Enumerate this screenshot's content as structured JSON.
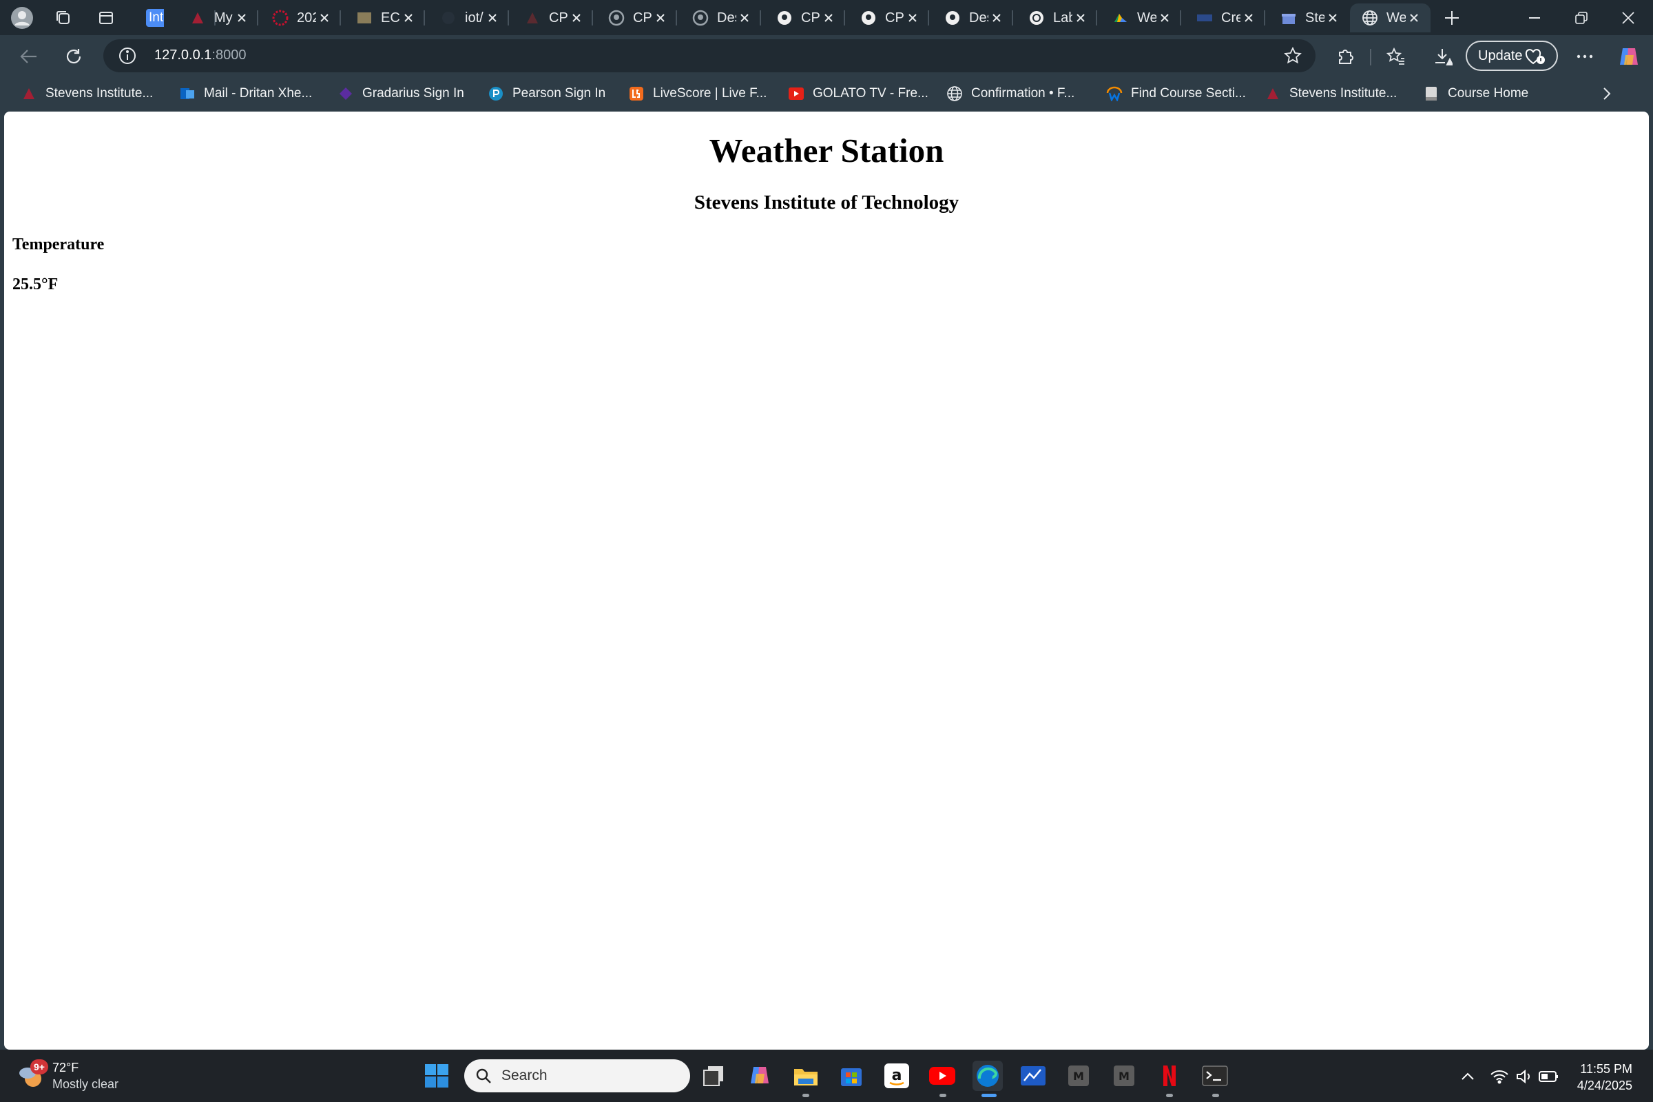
{
  "browser": {
    "tabs": [
      {
        "label": "Int",
        "icon": "int-badge-icon"
      },
      {
        "label": "My",
        "icon": "stevens-logo-icon"
      },
      {
        "label": "202",
        "icon": "sunburst-icon"
      },
      {
        "label": "ECE",
        "icon": "picture-icon"
      },
      {
        "label": "iot/",
        "icon": "blank-page-icon"
      },
      {
        "label": "CPE",
        "icon": "stevens-logo-icon"
      },
      {
        "label": "CPE",
        "icon": "github-icon"
      },
      {
        "label": "Des",
        "icon": "github-icon"
      },
      {
        "label": "CPE",
        "icon": "github-icon"
      },
      {
        "label": "CPE",
        "icon": "github-icon"
      },
      {
        "label": "Des",
        "icon": "github-icon"
      },
      {
        "label": "Lab",
        "icon": "openai-icon"
      },
      {
        "label": "Wel",
        "icon": "cloud-icon"
      },
      {
        "label": "Cre",
        "icon": "rpi-icon"
      },
      {
        "label": "Ste",
        "icon": "gift-icon"
      },
      {
        "label": "We",
        "icon": "globe-icon",
        "active": true
      }
    ],
    "address": {
      "host": "127.0.0.1",
      "port": ":8000"
    },
    "update_label": "Update",
    "bookmarks": [
      {
        "label": "Stevens Institute...",
        "icon": "stevens-logo-icon"
      },
      {
        "label": "Mail - Dritan Xhe...",
        "icon": "outlook-icon"
      },
      {
        "label": "Gradarius Sign In",
        "icon": "gradarius-icon"
      },
      {
        "label": "Pearson Sign In",
        "icon": "pearson-icon"
      },
      {
        "label": "LiveScore | Live F...",
        "icon": "livescore-icon"
      },
      {
        "label": "GOLATO TV - Fre...",
        "icon": "youtube-icon"
      },
      {
        "label": "Confirmation • F...",
        "icon": "globe-icon"
      },
      {
        "label": "Find Course Secti...",
        "icon": "workday-icon"
      },
      {
        "label": "Stevens Institute...",
        "icon": "stevens-logo-icon"
      },
      {
        "label": "Course Home",
        "icon": "page-icon"
      }
    ]
  },
  "page": {
    "title": "Weather Station",
    "subtitle": "Stevens Institute of Technology",
    "section_heading": "Temperature",
    "temperature": "25.5°F"
  },
  "taskbar": {
    "weather_temp": "72°F",
    "weather_desc": "Mostly clear",
    "weather_badge": "9+",
    "search_placeholder": "Search",
    "time": "11:55 PM",
    "date": "4/24/2025"
  },
  "colors": {
    "tab_strip": "#202a32",
    "toolbar": "#2e3c46",
    "taskbar": "#1f2328",
    "accent": "#4c8df6"
  }
}
